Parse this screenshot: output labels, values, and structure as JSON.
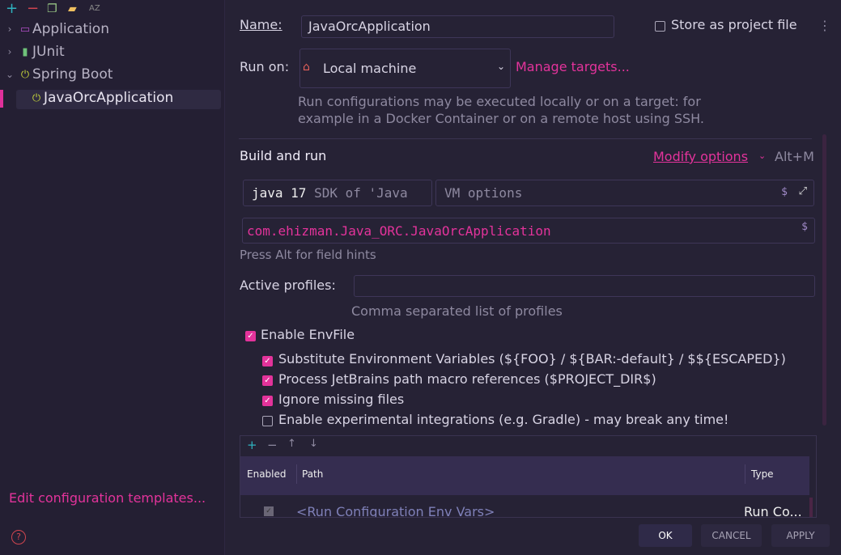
{
  "toolbar": {
    "icons": [
      "plus-icon",
      "minus-icon",
      "copy-icon",
      "new-folder-icon",
      "sort-az-icon"
    ],
    "sort_label": "AZ"
  },
  "tree": {
    "items": [
      {
        "label": "Application",
        "icon": "application-icon",
        "expanded": false
      },
      {
        "label": "JUnit",
        "icon": "junit-icon",
        "expanded": false
      },
      {
        "label": "Spring Boot",
        "icon": "spring-boot-icon",
        "expanded": true
      },
      {
        "label": "JavaOrcApplication",
        "icon": "spring-boot-icon",
        "selected": true
      }
    ]
  },
  "sidebar": {
    "edit_templates": "Edit configuration templates..."
  },
  "form": {
    "name_label": "Name:",
    "name_value": "JavaOrcApplication",
    "store_label": "Store as project file",
    "store_checked": false,
    "run_on_label": "Run on:",
    "run_on_value": "Local machine",
    "manage_targets": "Manage targets...",
    "run_on_hint_1": "Run configurations may be executed locally or on a target: for",
    "run_on_hint_2": "example in a Docker Container or on a remote host using SSH.",
    "build_title": "Build and run",
    "modify_options": "Modify options",
    "modify_shortcut": "Alt+M",
    "jdk_main": "java 17",
    "jdk_detail": "SDK of 'Java",
    "vm_placeholder": "VM options",
    "main_class": "com.ehizman.Java_ORC.JavaOrcApplication",
    "field_hint": "Press Alt for field hints",
    "profiles_label": "Active profiles:",
    "profiles_value": "",
    "profiles_hint": "Comma separated list of profiles",
    "envfile_label": "Enable EnvFile",
    "envfile_checked": true,
    "options": [
      {
        "label": "Substitute Environment Variables (${FOO} / ${BAR:-default} / $${ESCAPED})",
        "checked": true
      },
      {
        "label": "Process JetBrains path macro references ($PROJECT_DIR$)",
        "checked": true
      },
      {
        "label": "Ignore missing files",
        "checked": true
      },
      {
        "label": "Enable experimental integrations (e.g. Gradle) - may break any time!",
        "checked": false
      }
    ]
  },
  "env_table": {
    "columns": [
      "Enabled",
      "Path",
      "Type"
    ],
    "rows": [
      {
        "enabled": true,
        "path": "<Run Configuration Env Vars>",
        "type": "Run Co..."
      }
    ]
  },
  "buttons": {
    "ok": "OK",
    "cancel": "CANCEL",
    "apply": "APPLY"
  },
  "colors": {
    "accent": "#e3339b",
    "background": "#262235"
  }
}
